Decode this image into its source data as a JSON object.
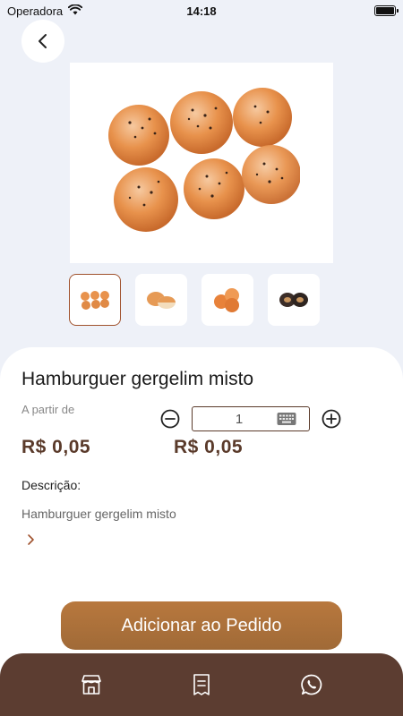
{
  "status_bar": {
    "carrier": "Operadora",
    "time": "14:18"
  },
  "product": {
    "name": "Hamburguer gergelim misto",
    "from_label": "A partir de",
    "price_from": "R$ 0,05",
    "price_total": "R$ 0,05",
    "quantity": "1",
    "description_label": "Descrição:",
    "description_text": "Hamburguer gergelim misto"
  },
  "thumbnails": [
    {
      "name": "thumb-1",
      "active": true
    },
    {
      "name": "thumb-2",
      "active": false
    },
    {
      "name": "thumb-3",
      "active": false
    },
    {
      "name": "thumb-4",
      "active": false
    }
  ],
  "actions": {
    "add_label": "Adicionar ao Pedido"
  },
  "colors": {
    "brand_brown": "#5c3d31",
    "button_gradient": "#b8783e",
    "price": "#5a3a2a",
    "background": "#eef1f8"
  },
  "bottom_nav": {
    "items": [
      "store-icon",
      "receipt-icon",
      "whatsapp-icon"
    ]
  }
}
